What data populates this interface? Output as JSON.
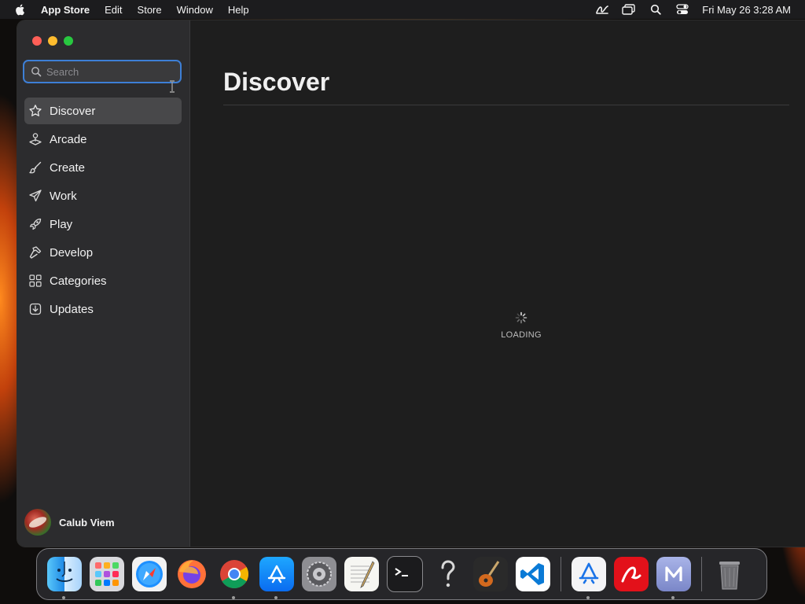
{
  "menubar": {
    "app_name": "App Store",
    "menus": [
      "Edit",
      "Store",
      "Window",
      "Help"
    ],
    "clock": "Fri May 26  3:28 AM",
    "status_icons": [
      "scribble-icon",
      "screen-mirror-icon",
      "spotlight-search-icon",
      "control-center-icon"
    ]
  },
  "search": {
    "placeholder": "Search",
    "value": ""
  },
  "sidebar": {
    "items": [
      {
        "label": "Discover",
        "icon": "star-icon",
        "active": true
      },
      {
        "label": "Arcade",
        "icon": "joystick-icon",
        "active": false
      },
      {
        "label": "Create",
        "icon": "brush-icon",
        "active": false
      },
      {
        "label": "Work",
        "icon": "paper-plane-icon",
        "active": false
      },
      {
        "label": "Play",
        "icon": "rocket-icon",
        "active": false
      },
      {
        "label": "Develop",
        "icon": "hammer-icon",
        "active": false
      },
      {
        "label": "Categories",
        "icon": "grid-icon",
        "active": false
      },
      {
        "label": "Updates",
        "icon": "download-icon",
        "active": false
      }
    ],
    "user_name": "Calub Viem"
  },
  "main": {
    "title": "Discover",
    "loading_text": "LOADING"
  },
  "dock": {
    "apps": [
      {
        "name": "finder-icon",
        "running": true
      },
      {
        "name": "launchpad-icon",
        "running": false
      },
      {
        "name": "safari-icon",
        "running": false
      },
      {
        "name": "firefox-icon",
        "running": false
      },
      {
        "name": "chrome-icon",
        "running": true
      },
      {
        "name": "app-store-icon",
        "running": true
      },
      {
        "name": "system-settings-icon",
        "running": false
      },
      {
        "name": "textedit-icon",
        "running": false
      },
      {
        "name": "terminal-icon",
        "running": false
      },
      {
        "name": "help-icon",
        "running": false
      },
      {
        "name": "garageband-icon",
        "running": false
      },
      {
        "name": "vscode-icon",
        "running": false
      },
      {
        "name": "xcode-instruments-icon",
        "running": true
      },
      {
        "name": "avira-icon",
        "running": false
      },
      {
        "name": "m-app-icon",
        "running": true
      },
      {
        "name": "trash-icon",
        "running": false
      }
    ]
  },
  "colors": {
    "accent": "#3d7fd6",
    "window_bg": "#1e1e1e",
    "sidebar_bg": "#2c2c2e",
    "active_item_bg": "#48484a"
  }
}
